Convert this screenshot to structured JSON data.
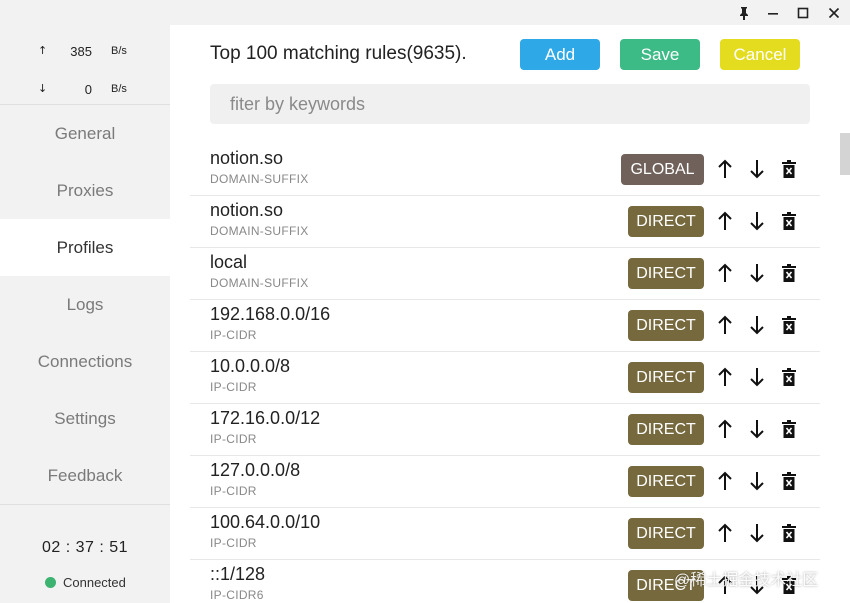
{
  "window": {
    "controls": [
      "pin-icon",
      "minimize-icon",
      "maximize-icon",
      "close-icon"
    ]
  },
  "sidebar": {
    "upload": {
      "arrow": "↑",
      "value": "385",
      "unit": "B/s"
    },
    "download": {
      "arrow": "↓",
      "value": "0",
      "unit": "B/s"
    },
    "nav": [
      {
        "label": "General"
      },
      {
        "label": "Proxies"
      },
      {
        "label": "Profiles",
        "active": true
      },
      {
        "label": "Logs"
      },
      {
        "label": "Connections"
      },
      {
        "label": "Settings"
      },
      {
        "label": "Feedback"
      }
    ],
    "timer": "02 : 37 : 51",
    "status": {
      "label": "Connected",
      "color": "#3cb371"
    }
  },
  "main": {
    "title": "Top 100 matching rules(9635).",
    "buttons": {
      "add": {
        "label": "Add",
        "color": "#2ea8e6"
      },
      "save": {
        "label": "Save",
        "color": "#3cbb86"
      },
      "cancel": {
        "label": "Cancel",
        "color": "#e4dc1f"
      }
    },
    "search": {
      "placeholder": "fiter by keywords",
      "value": ""
    },
    "rules": [
      {
        "payload": "notion.so",
        "type": "DOMAIN-SUFFIX",
        "policy": "GLOBAL"
      },
      {
        "payload": "notion.so",
        "type": "DOMAIN-SUFFIX",
        "policy": "DIRECT"
      },
      {
        "payload": "local",
        "type": "DOMAIN-SUFFIX",
        "policy": "DIRECT"
      },
      {
        "payload": "192.168.0.0/16",
        "type": "IP-CIDR",
        "policy": "DIRECT"
      },
      {
        "payload": "10.0.0.0/8",
        "type": "IP-CIDR",
        "policy": "DIRECT"
      },
      {
        "payload": "172.16.0.0/12",
        "type": "IP-CIDR",
        "policy": "DIRECT"
      },
      {
        "payload": "127.0.0.0/8",
        "type": "IP-CIDR",
        "policy": "DIRECT"
      },
      {
        "payload": "100.64.0.0/10",
        "type": "IP-CIDR",
        "policy": "DIRECT"
      },
      {
        "payload": "::1/128",
        "type": "IP-CIDR6",
        "policy": "DIRECT"
      }
    ],
    "policy_colors": {
      "GLOBAL": "#70625a",
      "DIRECT": "#76693e"
    }
  },
  "watermark": "@稀土掘金技术社区"
}
